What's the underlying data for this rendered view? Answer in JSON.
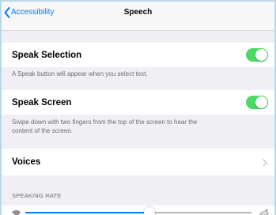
{
  "navbar": {
    "back_label": "Accessibility",
    "title": "Speech"
  },
  "speak_selection": {
    "label": "Speak Selection",
    "toggle_on": true,
    "footer": "A Speak button will appear when you select text."
  },
  "speak_screen": {
    "label": "Speak Screen",
    "toggle_on": true,
    "footer_line1": "Swipe down with two fingers from the top of the screen to hear the",
    "footer_line2": "content of the screen."
  },
  "voices": {
    "label": "Voices"
  },
  "speaking_rate": {
    "header": "SPEAKING RATE",
    "value": 0.55
  },
  "colors": {
    "accent": "#007aff",
    "toggle_on": "#4cd964",
    "background": "#efeff4",
    "secondary_text": "#6d6d72"
  },
  "icons": {
    "back": "chevron-left-icon",
    "disclosure": "chevron-right-icon",
    "slow": "tortoise-icon",
    "fast": "hare-icon"
  }
}
